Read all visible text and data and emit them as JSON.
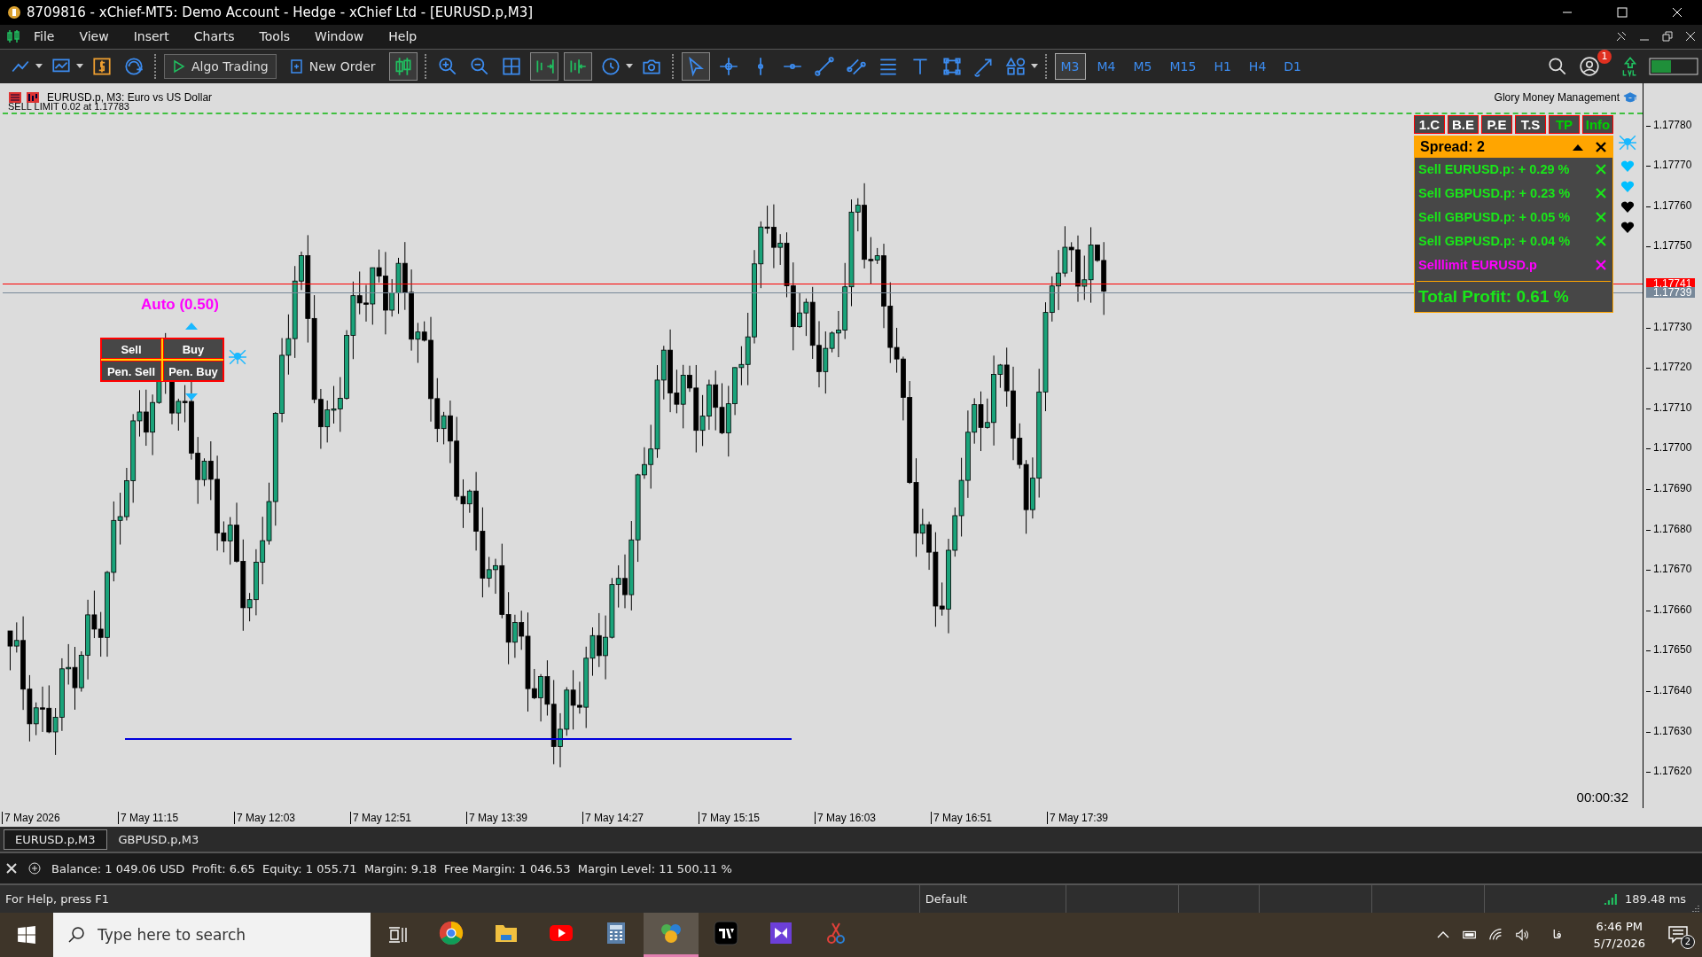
{
  "window": {
    "title": "8709816 - xChief-MT5: Demo Account - Hedge - xChief Ltd - [EURUSD.p,M3]"
  },
  "menu": [
    "File",
    "View",
    "Insert",
    "Charts",
    "Tools",
    "Window",
    "Help"
  ],
  "toolbar": {
    "algo_trading": "Algo Trading",
    "new_order": "New Order",
    "timeframes": [
      {
        "label": "M3",
        "selected": true
      },
      {
        "label": "M4",
        "selected": false
      },
      {
        "label": "M5",
        "selected": false
      },
      {
        "label": "M15",
        "selected": false
      },
      {
        "label": "H1",
        "selected": false
      },
      {
        "label": "H4",
        "selected": false
      },
      {
        "label": "D1",
        "selected": false
      }
    ],
    "notification_count": "1"
  },
  "chart": {
    "symbol": "EURUSD.p, M3:  Euro vs US Dollar",
    "order_label": "SELL LIMIT 0.02 at 1.17783",
    "expert": "Glory Money Management",
    "lot_label": "Auto (0.50)",
    "trade_buttons": [
      "Sell",
      "Buy",
      "Pen. Sell",
      "Pen. Buy"
    ],
    "panel": {
      "tabs": [
        {
          "label": "1.C",
          "highlighted": false
        },
        {
          "label": "B.E",
          "highlighted": false
        },
        {
          "label": "P.E",
          "highlighted": false
        },
        {
          "label": "T.S",
          "highlighted": false
        },
        {
          "label": "TP",
          "highlighted": true
        },
        {
          "label": "Info",
          "highlighted": true
        }
      ],
      "spread": "Spread: 2",
      "positions": [
        {
          "text": "Sell EURUSD.p: + 0.29 %",
          "color": "#19e619"
        },
        {
          "text": "Sell GBPUSD.p: + 0.23 %",
          "color": "#19e619"
        },
        {
          "text": "Sell GBPUSD.p: + 0.05 %",
          "color": "#19e619"
        },
        {
          "text": "Sell GBPUSD.p: + 0.04 %",
          "color": "#19e619"
        },
        {
          "text": "Selllimit EURUSD.p",
          "color": "#ff00ff"
        }
      ],
      "total": "Total Profit: 0.61 %"
    },
    "markers": [
      {
        "color": "#00bfff"
      },
      {
        "color": "#00bfff"
      },
      {
        "color": "#000000"
      },
      {
        "color": "#000000"
      }
    ],
    "price_ticks": [
      "1.17780",
      "1.17770",
      "1.17760",
      "1.17750",
      "1.17730",
      "1.17720",
      "1.17710",
      "1.17700",
      "1.17690",
      "1.17680",
      "1.17670",
      "1.17660",
      "1.17650",
      "1.17640",
      "1.17630",
      "1.17620"
    ],
    "price_tags": [
      {
        "text": "1.17741",
        "color": "#ff0000"
      },
      {
        "text": "1.17739",
        "color": "#778899"
      }
    ],
    "time_labels": [
      "7 May 2026",
      "7 May 11:15",
      "7 May 12:03",
      "7 May 12:51",
      "7 May 13:39",
      "7 May 14:27",
      "7 May 15:15",
      "7 May 16:03",
      "7 May 16:51",
      "7 May 17:39"
    ],
    "timer": "00:00:32"
  },
  "chart_tabs": [
    {
      "label": "EURUSD.p,M3",
      "selected": true
    },
    {
      "label": "GBPUSD.p,M3",
      "selected": false
    }
  ],
  "account": "Balance: 1 049.06 USD  Profit: 6.65  Equity: 1 055.71  Margin: 9.18  Free Margin: 1 046.53  Margin Level: 11 500.11 %",
  "status": {
    "help": "For Help, press F1",
    "profile": "Default",
    "ping": "189.48 ms"
  },
  "taskbar": {
    "search_placeholder": "Type here to search",
    "apps": [
      {
        "kind": "chrome",
        "selected": false
      },
      {
        "kind": "folder",
        "selected": false
      },
      {
        "kind": "video",
        "selected": false
      },
      {
        "kind": "calculator",
        "selected": false
      },
      {
        "kind": "trading",
        "selected": true
      },
      {
        "kind": "tv",
        "selected": false
      },
      {
        "kind": "studio",
        "selected": false
      },
      {
        "kind": "snip",
        "selected": false
      }
    ],
    "language": "فا",
    "time": "6:46 PM",
    "date": "5/7/2026",
    "notifications": "2"
  }
}
